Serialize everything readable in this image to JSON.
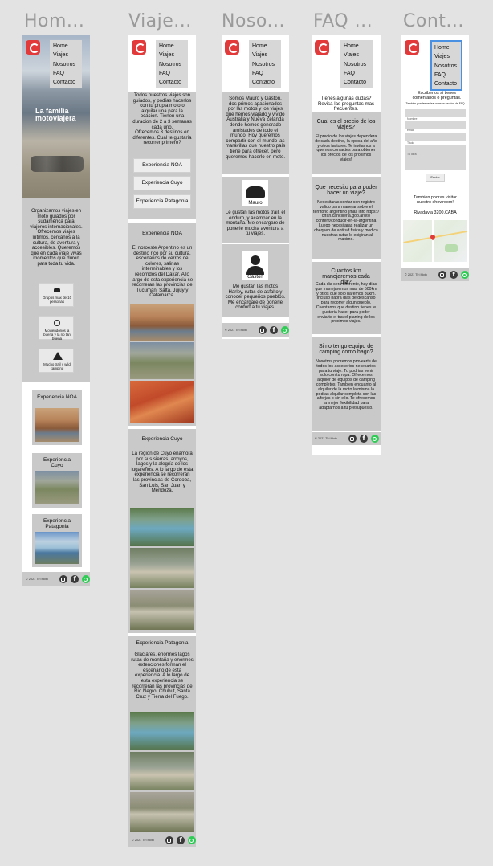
{
  "titles": [
    "Hom...",
    "Viaje...",
    "Noso...",
    "FAQ ...",
    "Cont..."
  ],
  "menu": [
    "Home",
    "Viajes",
    "Nosotros",
    "FAQ",
    "Contacto"
  ],
  "footer": {
    "copyright": "© 2021 Tiri Moto"
  },
  "home": {
    "hero_title": "La familia motoviajera",
    "intro": "Organizamos viajes en moto guiados por sudamérica para viajeros internacionales. Ofrecemos viajes íntimos, cercanos a la cultura, de aventura y accesibles. Queremos que en cada viaje vivas momentos que duren para toda tu vida.",
    "features": [
      {
        "icon": "group-icon",
        "label": "Grupos max de 10 personas"
      },
      {
        "icon": "smile-icon",
        "label": "Moviéndonos la buena y la no tan buena"
      },
      {
        "icon": "mountain-icon",
        "label": "Mucho trail y wild camping"
      }
    ],
    "experiences": [
      "Experiencia NOA",
      "Experiencia Cuyo",
      "Experiencia Patagonia"
    ]
  },
  "viajes": {
    "intro": "Todos nuestros viajes son guiados, y podías hacerlos con tu propia moto o alquilar una para la ocacion. Tienen una duracion de 2 a 3 semanas cada uno.",
    "offer": "Ofrecemos 3 destinos en diferentes. Cual te gustaría recorrer primero?",
    "buttons": [
      "Experiencia NOA",
      "Experiencia Cuyo",
      "Experiencia Patagonia"
    ],
    "noa": {
      "title": "Experiencia NOA",
      "text": "El noroeste Argentino es un destino rico por su cultura, escenarios de cerros de colores, salinas interminables y los recorridos del Dakar. A lo largo de esta experiencia se recorreran las provincias de Tucuman, Salta, Jujuy y Catamarca."
    },
    "cuyo": {
      "title": "Experiencia Cuyo",
      "text": "La region de Cuyo enamora por sus sierras, arroyos, lagos y la alegría de los lugareños. A lo largo de esta experiencia se recorreran las provincias de Cordoba, San Luis, San Juan y Mendoza."
    },
    "patagonia": {
      "title": "Experiencia Patagonia",
      "text": "Glaciares, enormes lagos rutas de montaña y enormes extenciones forman el escenario de esta experiencia. A lo largo de esta experiencia se recorreran las provincias de Rio Negro, Chubut, Santa Cruz y Tierra del Fuego."
    }
  },
  "nosotros": {
    "intro": "Somos Mauro y Gaston, dos primos apasionados por las motos y los viajes que hemos viajado y vivido Australia y Nueva Zelanda donde hemos generado amistades de todo el mundo. Hoy queremos compartir con el mundo las maravillas que nuestro país tiene para ofrecer, pero queremos hacerlo en moto.",
    "people": [
      {
        "name": "Mauro",
        "text": "Le gustan las motos trail, el enduro, y acampar en la montaña. Me encargare de ponerle mucha aventura a tu viajes."
      },
      {
        "name": "Gaston",
        "text": "Me gustan las motos Harley, rutas de asfalto y conocer pequeños pueblos. Me encargare de ponerle confort a tu viajes."
      }
    ]
  },
  "faq": {
    "intro": "Tienes algunas dudas? Revisa las preguntas mas frecuentes.",
    "items": [
      {
        "q": "Cual es el precio de los viajes?",
        "a": "El precio de los viajes dependera de cada destino, la epoca del año y otros factores. Te invitamos a que nos contactes para obtener los precios de los proximos viajes!"
      },
      {
        "q": "Que necesito para poder hacer un viaje?",
        "a": "Necesitaras contar con registro valido para manejar sobre el territorio argentino (mas info https:// cfran.cancilleria.gob.ar/es/ content/conducir-en-la-argentina Luego necesitaras realizar un chequeo de aptitud fisica y medica , nuestras rutas le exigiran al maximo."
      },
      {
        "q": "Cuantos km manejaremos cada dia?",
        "a": "Cada dia sera diferente, hay dias que manejaremos mas de 500km y otros que solo haremos 80km. Incluso habra dias de descanso para recorrer algun pueblo. Cuentanos que destino tienes te gustaria hacer para poder enviarte el travel planing de los proximos viajes."
      },
      {
        "q": "Si no tengo equipo de camping como hago?",
        "a": "Nosotros podremos proveerte de todos los accesorios necesarios para tu viaje. Tu podrias venir solo con tu ropa. Ofrecemos alquiler de equipos de camping completos. Tambien encuanto al alquiler de la moto la misma la podras alquilar completa con las alforjas o sin ello. Te ofrecemos la mejor flexibilidad para adaptarnos a tu presupuesto."
      }
    ]
  },
  "contacto": {
    "intro": "Escribenos si tienes comentarios o preguntas.",
    "subintro": "Tambien puedes revisar nuestra seccion de FAQ",
    "fields": [
      "Nombre",
      "email",
      "Titulo",
      "Tu idea"
    ],
    "send": "Enviar",
    "showroom": "Tambien podras visitar nuestro showroom!",
    "address": "Rivadavia 3200,CABA"
  }
}
